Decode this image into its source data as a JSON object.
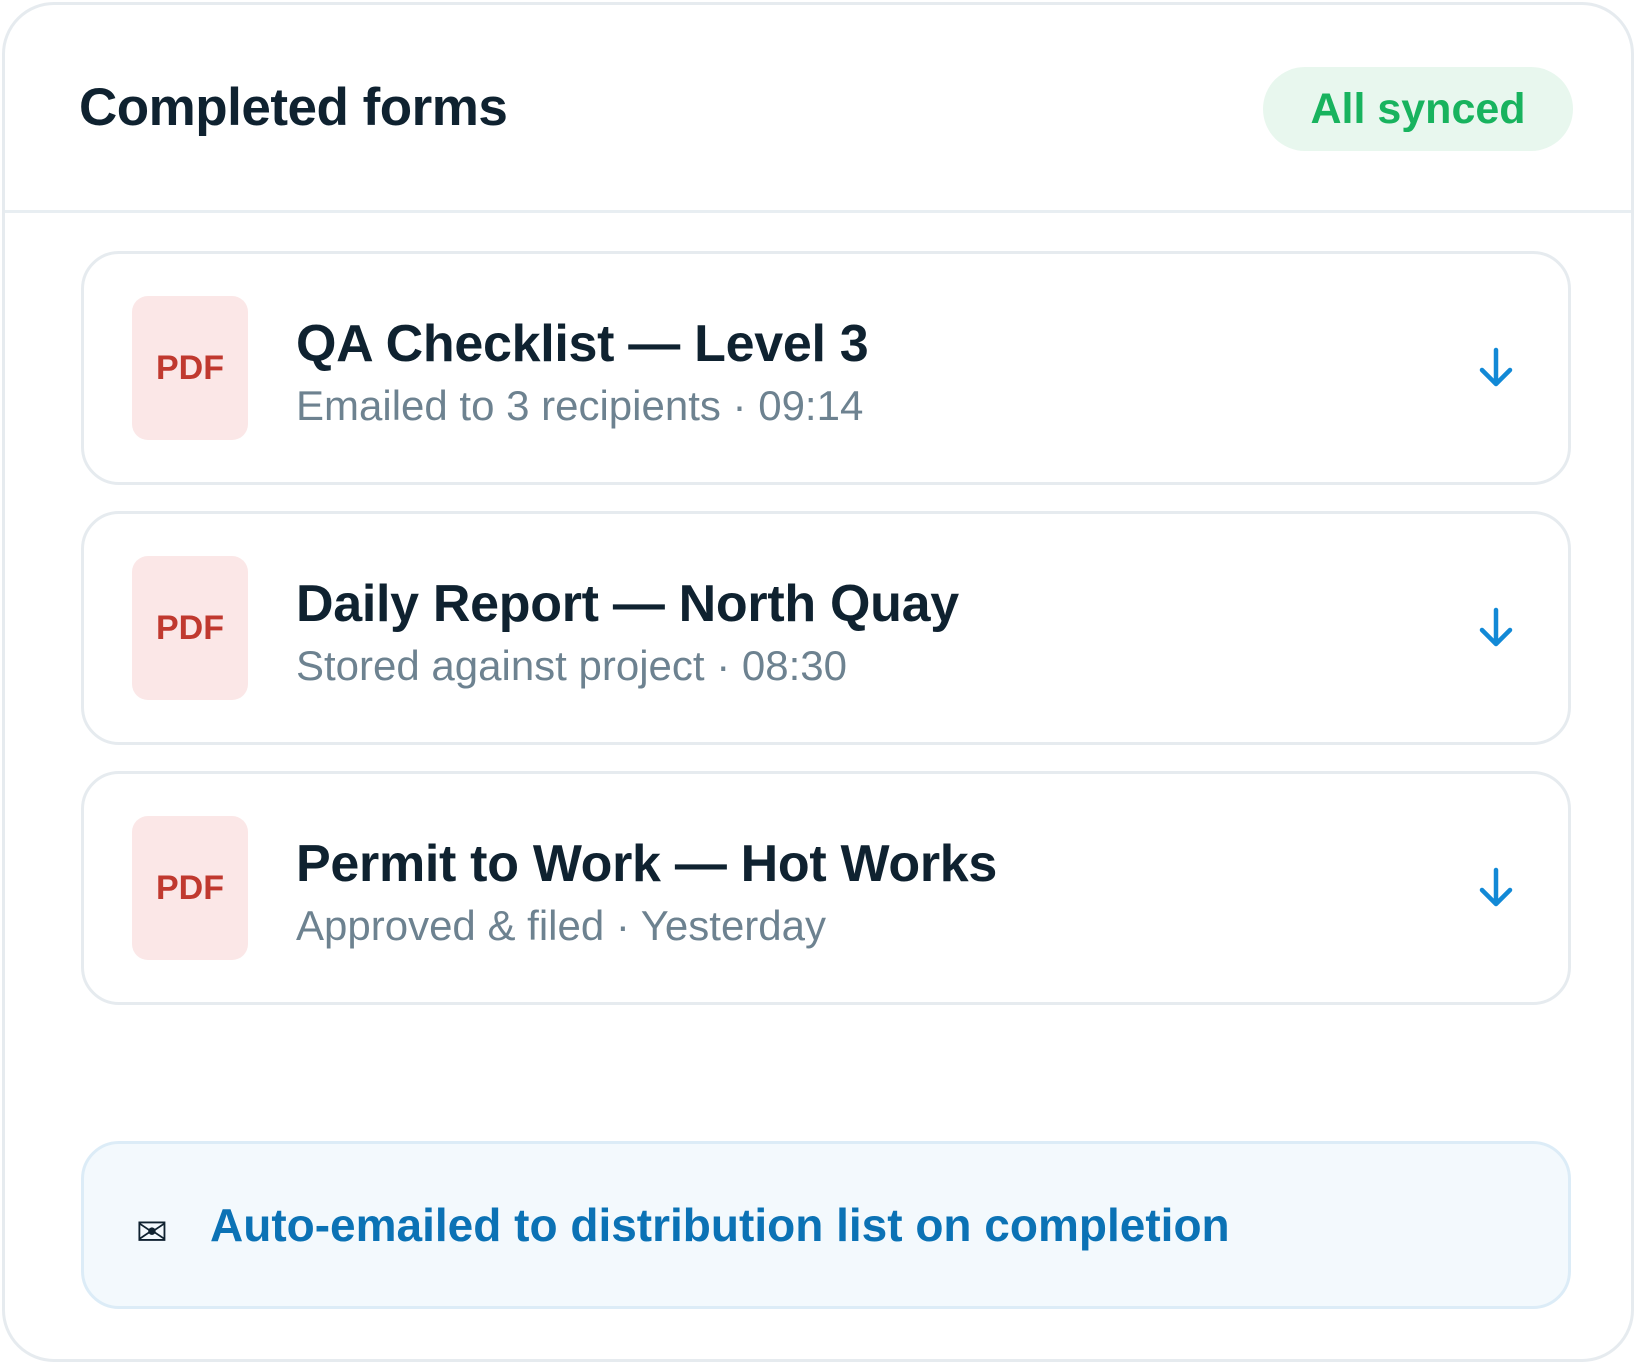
{
  "header": {
    "title": "Completed forms",
    "status_badge": "All synced"
  },
  "forms": [
    {
      "file_type": "PDF",
      "title": "QA Checklist — Level 3",
      "subtitle": "Emailed to 3 recipients · 09:14",
      "action_icon": "download-icon"
    },
    {
      "file_type": "PDF",
      "title": "Daily Report — North Quay",
      "subtitle": "Stored against project · 08:30",
      "action_icon": "download-icon"
    },
    {
      "file_type": "PDF",
      "title": "Permit to Work — Hot Works",
      "subtitle": "Approved & filed · Yesterday",
      "action_icon": "download-icon"
    }
  ],
  "notice": {
    "icon": "envelope-icon",
    "glyph": "✉",
    "text": "Auto-emailed to distribution list on completion"
  },
  "colors": {
    "title": "#0f2230",
    "badge_text": "#18b35e",
    "badge_bg": "#e8f7ee",
    "pdf_text": "#c0392f",
    "pdf_bg": "#fbe7e7",
    "subtitle": "#6d8290",
    "accent": "#0b72b5",
    "download_icon": "#1289d6"
  }
}
